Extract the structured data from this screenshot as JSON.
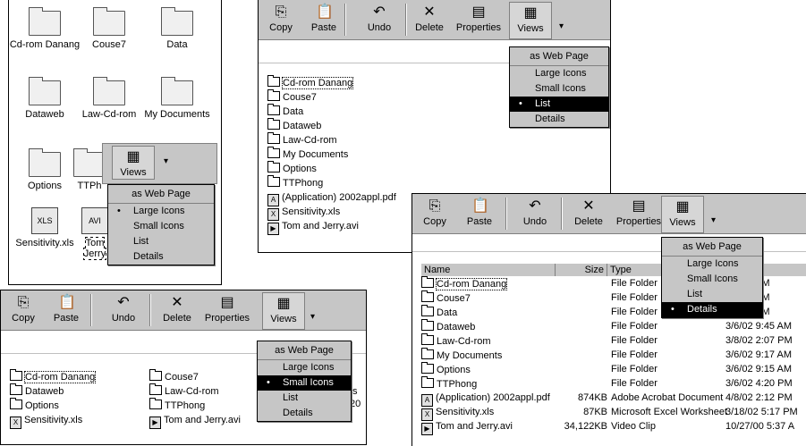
{
  "toolbar": {
    "copy": "Copy",
    "paste": "Paste",
    "undo": "Undo",
    "delete": "Delete",
    "properties": "Properties",
    "views": "Views"
  },
  "menu": {
    "web": "as Web Page",
    "large": "Large Icons",
    "small": "Small Icons",
    "list": "List",
    "details": "Details",
    "bullet": "•"
  },
  "large_icons": [
    "Cd-rom Danang",
    "Couse7",
    "Data",
    "Dataweb",
    "Law-Cd-rom",
    "My Documents",
    "Options",
    "TTPhong",
    "Sensitivity.xls",
    "Tom and Jerry.avi"
  ],
  "large_icons_truncated": {
    "ttphong": "TTPh",
    "tom": "Tom\nJerry"
  },
  "list_items": [
    "Cd-rom Danang",
    "Couse7",
    "Data",
    "Dataweb",
    "Law-Cd-rom",
    "My Documents",
    "Options",
    "TTPhong",
    "(Application) 2002appl.pdf",
    "Sensitivity.xls",
    "Tom and Jerry.avi"
  ],
  "small_icons": {
    "col1": [
      "Cd-rom Danang",
      "Dataweb",
      "Options",
      "Sensitivity.xls"
    ],
    "col2": [
      "Couse7",
      "Law-Cd-rom",
      "TTPhong",
      "Tom and Jerry.avi"
    ],
    "col3_partial": [
      "ts",
      "20"
    ]
  },
  "details": {
    "headers": {
      "name": "Name",
      "size": "Size",
      "type": "Type",
      "modified": "ed"
    },
    "rows": [
      {
        "name": "Cd-rom Danang",
        "size": "",
        "type": "File Folder",
        "modified": "2 9:47 AM"
      },
      {
        "name": "Couse7",
        "size": "",
        "type": "File Folder",
        "modified": "2 9:16 AM"
      },
      {
        "name": "Data",
        "size": "",
        "type": "File Folder",
        "modified": "2 9:38 AM"
      },
      {
        "name": "Dataweb",
        "size": "",
        "type": "File Folder",
        "modified": "3/6/02 9:45 AM"
      },
      {
        "name": "Law-Cd-rom",
        "size": "",
        "type": "File Folder",
        "modified": "3/8/02 2:07 PM"
      },
      {
        "name": "My Documents",
        "size": "",
        "type": "File Folder",
        "modified": "3/6/02 9:17 AM"
      },
      {
        "name": "Options",
        "size": "",
        "type": "File Folder",
        "modified": "3/6/02 9:15 AM"
      },
      {
        "name": "TTPhong",
        "size": "",
        "type": "File Folder",
        "modified": "3/6/02 4:20 PM"
      },
      {
        "name": "(Application) 2002appl.pdf",
        "size": "874KB",
        "type": "Adobe Acrobat Document",
        "modified": "4/8/02 2:12 PM"
      },
      {
        "name": "Sensitivity.xls",
        "size": "87KB",
        "type": "Microsoft Excel Worksheet",
        "modified": "3/18/02 5:17 PM"
      },
      {
        "name": "Tom and Jerry.avi",
        "size": "34,122KB",
        "type": "Video Clip",
        "modified": "10/27/00 5:37 A"
      }
    ]
  }
}
